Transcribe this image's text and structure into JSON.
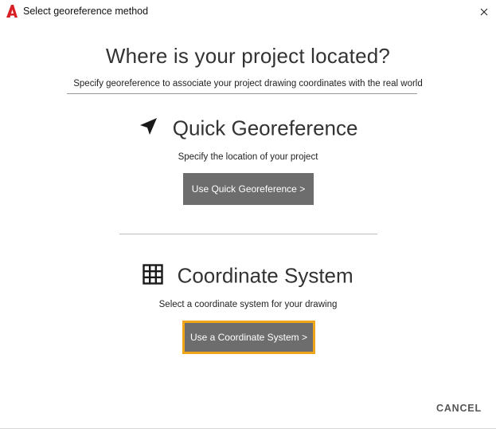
{
  "window": {
    "title": "Select georeference method"
  },
  "header": {
    "headline": "Where is your project located?",
    "subline": "Specify georeference to associate your project drawing coordinates with the real world"
  },
  "quick_georeference": {
    "title": "Quick Georeference",
    "description": "Specify the location of your project",
    "button_label": "Use Quick Georeference >",
    "icon": "navigation-arrow-icon"
  },
  "coordinate_system": {
    "title": "Coordinate System",
    "description": "Select a coordinate system for your drawing",
    "button_label": "Use a Coordinate System >",
    "icon": "grid-icon"
  },
  "footer": {
    "cancel_label": "CANCEL"
  },
  "colors": {
    "button_bg": "#6d6d6d",
    "focus_outline": "#f0a417",
    "app_icon_red": "#d81f26"
  }
}
